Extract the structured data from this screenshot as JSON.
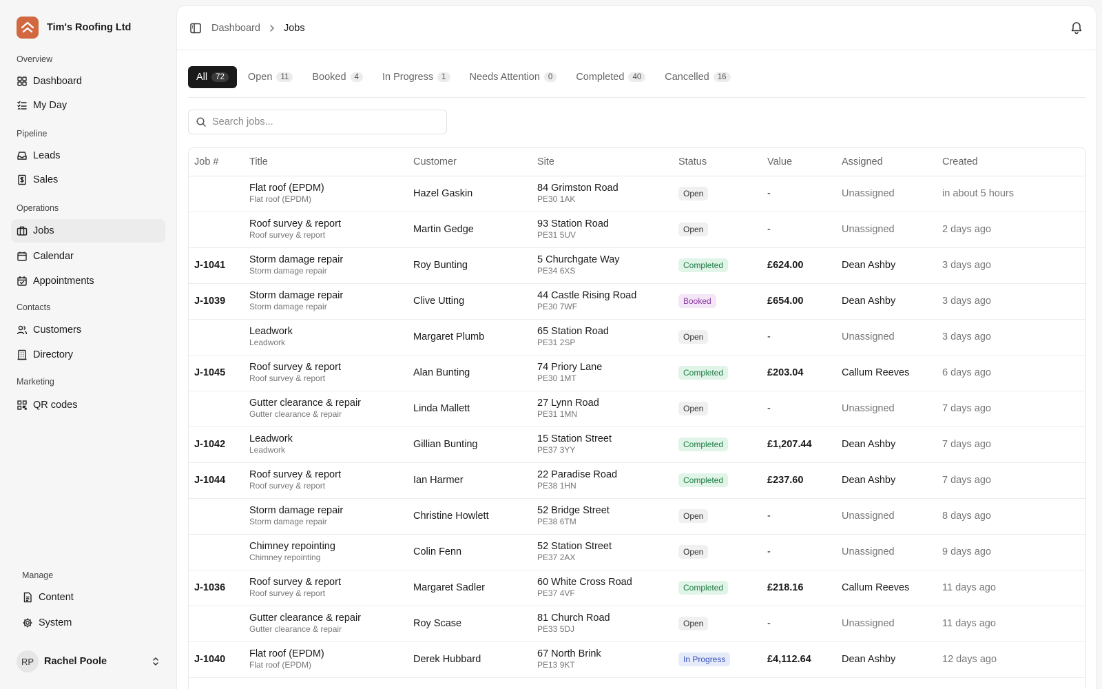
{
  "brand": {
    "name": "Tim's Roofing Ltd",
    "accent": "#d2683f"
  },
  "sidebar": {
    "sections": [
      {
        "label": "Overview",
        "items": [
          {
            "label": "Dashboard",
            "icon": "grid-icon"
          },
          {
            "label": "My Day",
            "icon": "list-check-icon"
          }
        ]
      },
      {
        "label": "Pipeline",
        "items": [
          {
            "label": "Leads",
            "icon": "inbox-icon"
          },
          {
            "label": "Sales",
            "icon": "receipt-icon"
          }
        ]
      },
      {
        "label": "Operations",
        "items": [
          {
            "label": "Jobs",
            "icon": "briefcase-icon",
            "active": true
          },
          {
            "label": "Calendar",
            "icon": "calendar-icon"
          },
          {
            "label": "Appointments",
            "icon": "calendar-check-icon"
          }
        ]
      },
      {
        "label": "Contacts",
        "items": [
          {
            "label": "Customers",
            "icon": "users-icon"
          },
          {
            "label": "Directory",
            "icon": "building-icon"
          }
        ]
      },
      {
        "label": "Marketing",
        "items": [
          {
            "label": "QR codes",
            "icon": "qr-icon"
          }
        ]
      }
    ],
    "manage": {
      "label": "Manage",
      "items": [
        {
          "label": "Content",
          "icon": "file-icon"
        },
        {
          "label": "System",
          "icon": "gear-icon"
        }
      ]
    },
    "user": {
      "initials": "RP",
      "name": "Rachel Poole"
    }
  },
  "breadcrumb": {
    "parent": "Dashboard",
    "current": "Jobs"
  },
  "tabs": [
    {
      "label": "All",
      "count": "72",
      "active": true
    },
    {
      "label": "Open",
      "count": "11"
    },
    {
      "label": "Booked",
      "count": "4"
    },
    {
      "label": "In Progress",
      "count": "1"
    },
    {
      "label": "Needs Attention",
      "count": "0"
    },
    {
      "label": "Completed",
      "count": "40"
    },
    {
      "label": "Cancelled",
      "count": "16"
    }
  ],
  "search": {
    "placeholder": "Search jobs...",
    "value": ""
  },
  "table": {
    "headers": [
      "Job #",
      "Title",
      "Customer",
      "Site",
      "Status",
      "Value",
      "Assigned",
      "Created"
    ],
    "rows": [
      {
        "job": "",
        "title": "Flat roof (EPDM)",
        "subtitle": "Flat roof (EPDM)",
        "customer": "Hazel Gaskin",
        "site": "84 Grimston Road",
        "postcode": "PE30 1AK",
        "status": "Open",
        "value": "-",
        "assigned": "Unassigned",
        "created": "in about 5 hours"
      },
      {
        "job": "",
        "title": "Roof survey & report",
        "subtitle": "Roof survey & report",
        "customer": "Martin Gedge",
        "site": "93 Station Road",
        "postcode": "PE31 5UV",
        "status": "Open",
        "value": "-",
        "assigned": "Unassigned",
        "created": "2 days ago"
      },
      {
        "job": "J-1041",
        "title": "Storm damage repair",
        "subtitle": "Storm damage repair",
        "customer": "Roy Bunting",
        "site": "5 Churchgate Way",
        "postcode": "PE34 6XS",
        "status": "Completed",
        "value": "£624.00",
        "assigned": "Dean Ashby",
        "created": "3 days ago"
      },
      {
        "job": "J-1039",
        "title": "Storm damage repair",
        "subtitle": "Storm damage repair",
        "customer": "Clive Utting",
        "site": "44 Castle Rising Road",
        "postcode": "PE30 7WF",
        "status": "Booked",
        "value": "£654.00",
        "assigned": "Dean Ashby",
        "created": "3 days ago"
      },
      {
        "job": "",
        "title": "Leadwork",
        "subtitle": "Leadwork",
        "customer": "Margaret Plumb",
        "site": "65 Station Road",
        "postcode": "PE31 2SP",
        "status": "Open",
        "value": "-",
        "assigned": "Unassigned",
        "created": "3 days ago"
      },
      {
        "job": "J-1045",
        "title": "Roof survey & report",
        "subtitle": "Roof survey & report",
        "customer": "Alan Bunting",
        "site": "74 Priory Lane",
        "postcode": "PE30 1MT",
        "status": "Completed",
        "value": "£203.04",
        "assigned": "Callum Reeves",
        "created": "6 days ago"
      },
      {
        "job": "",
        "title": "Gutter clearance & repair",
        "subtitle": "Gutter clearance & repair",
        "customer": "Linda Mallett",
        "site": "27 Lynn Road",
        "postcode": "PE31 1MN",
        "status": "Open",
        "value": "-",
        "assigned": "Unassigned",
        "created": "7 days ago"
      },
      {
        "job": "J-1042",
        "title": "Leadwork",
        "subtitle": "Leadwork",
        "customer": "Gillian Bunting",
        "site": "15 Station Street",
        "postcode": "PE37 3YY",
        "status": "Completed",
        "value": "£1,207.44",
        "assigned": "Dean Ashby",
        "created": "7 days ago"
      },
      {
        "job": "J-1044",
        "title": "Roof survey & report",
        "subtitle": "Roof survey & report",
        "customer": "Ian Harmer",
        "site": "22 Paradise Road",
        "postcode": "PE38 1HN",
        "status": "Completed",
        "value": "£237.60",
        "assigned": "Dean Ashby",
        "created": "7 days ago"
      },
      {
        "job": "",
        "title": "Storm damage repair",
        "subtitle": "Storm damage repair",
        "customer": "Christine Howlett",
        "site": "52 Bridge Street",
        "postcode": "PE38 6TM",
        "status": "Open",
        "value": "-",
        "assigned": "Unassigned",
        "created": "8 days ago"
      },
      {
        "job": "",
        "title": "Chimney repointing",
        "subtitle": "Chimney repointing",
        "customer": "Colin Fenn",
        "site": "52 Station Street",
        "postcode": "PE37 2AX",
        "status": "Open",
        "value": "-",
        "assigned": "Unassigned",
        "created": "9 days ago"
      },
      {
        "job": "J-1036",
        "title": "Roof survey & report",
        "subtitle": "Roof survey & report",
        "customer": "Margaret Sadler",
        "site": "60 White Cross Road",
        "postcode": "PE37 4VF",
        "status": "Completed",
        "value": "£218.16",
        "assigned": "Callum Reeves",
        "created": "11 days ago"
      },
      {
        "job": "",
        "title": "Gutter clearance & repair",
        "subtitle": "Gutter clearance & repair",
        "customer": "Roy Scase",
        "site": "81 Church Road",
        "postcode": "PE33 5DJ",
        "status": "Open",
        "value": "-",
        "assigned": "Unassigned",
        "created": "11 days ago"
      },
      {
        "job": "J-1040",
        "title": "Flat roof (EPDM)",
        "subtitle": "Flat roof (EPDM)",
        "customer": "Derek Hubbard",
        "site": "67 North Brink",
        "postcode": "PE13 9KT",
        "status": "In Progress",
        "value": "£4,112.64",
        "assigned": "Dean Ashby",
        "created": "12 days ago"
      }
    ]
  }
}
